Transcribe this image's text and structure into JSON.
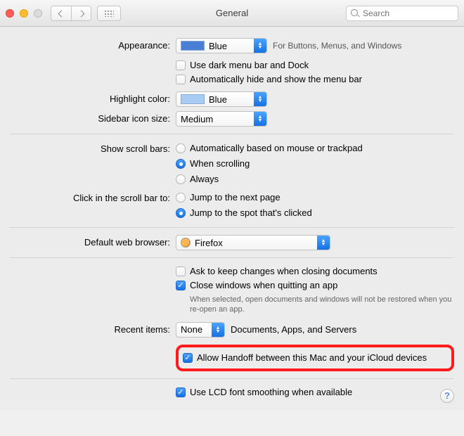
{
  "titlebar": {
    "title": "General",
    "search_placeholder": "Search"
  },
  "appearance": {
    "label": "Appearance:",
    "value": "Blue",
    "hint": "For Buttons, Menus, and Windows",
    "dark_menu": "Use dark menu bar and Dock",
    "auto_hide": "Automatically hide and show the menu bar"
  },
  "highlight": {
    "label": "Highlight color:",
    "value": "Blue"
  },
  "sidebar_size": {
    "label": "Sidebar icon size:",
    "value": "Medium"
  },
  "scrollbars": {
    "label": "Show scroll bars:",
    "opt_auto": "Automatically based on mouse or trackpad",
    "opt_scroll": "When scrolling",
    "opt_always": "Always"
  },
  "scrollclick": {
    "label": "Click in the scroll bar to:",
    "opt_page": "Jump to the next page",
    "opt_spot": "Jump to the spot that's clicked"
  },
  "browser": {
    "label": "Default web browser:",
    "value": "Firefox"
  },
  "docs": {
    "ask": "Ask to keep changes when closing documents",
    "close_quit": "Close windows when quitting an app",
    "fineprint": "When selected, open documents and windows will not be restored when you re-open an app."
  },
  "recent": {
    "label": "Recent items:",
    "value": "None",
    "suffix": "Documents, Apps, and Servers"
  },
  "handoff": {
    "label": "Allow Handoff between this Mac and your iCloud devices"
  },
  "lcd": {
    "label": "Use LCD font smoothing when available"
  },
  "help": "?"
}
